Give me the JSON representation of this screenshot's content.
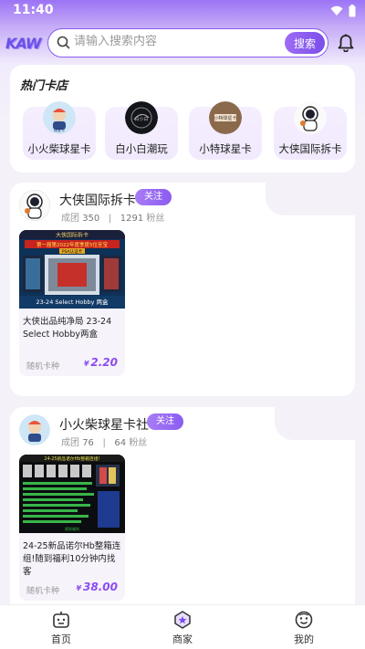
{
  "status": {
    "time": "11:40",
    "wifi_icon": "wifi-icon",
    "battery_icon": "battery-icon"
  },
  "header": {
    "logo": "KAW",
    "search_placeholder": "请输入搜索内容",
    "search_button": "搜索",
    "bell_icon": "bell-icon"
  },
  "hot_shops": {
    "title": "热门卡店",
    "items": [
      {
        "name": "小火柴球星卡"
      },
      {
        "name": "白小白潮玩"
      },
      {
        "name": "小特球星卡"
      },
      {
        "name": "大侠国际拆卡"
      }
    ]
  },
  "stores": [
    {
      "name": "大侠国际拆卡",
      "follow": "关注",
      "stats_label1": "成团",
      "stats_val1": "350",
      "stats_sep": "|",
      "stats_val2": "1291",
      "stats_label2": "粉丝",
      "product": {
        "img_line1": "大侠国际拆卡",
        "img_line2": "第一届第2022年度季度5位至宝",
        "img_badge": "PSA认证卡",
        "img_caption": "23-24 Select Hobby 两盒",
        "title": "大侠出品纯净局 23-24 Select Hobby两盒",
        "type": "随机卡种",
        "currency": "¥",
        "price": "2.20"
      }
    },
    {
      "name": "小火柴球星卡社",
      "follow": "关注",
      "stats_label1": "成团",
      "stats_val1": "76",
      "stats_sep": "|",
      "stats_val2": "64",
      "stats_label2": "粉丝",
      "product": {
        "img_line1": "24-25新品诺尔Hb整箱连组!",
        "img_line2": "随到福利",
        "title": "24-25新品诺尔Hb整箱连组!随到福利10分钟内找客",
        "type": "随机卡种",
        "currency": "¥",
        "price": "38.00"
      }
    }
  ],
  "bottom_nav": [
    {
      "label": "首页",
      "icon": "home-icon"
    },
    {
      "label": "商家",
      "icon": "store-icon"
    },
    {
      "label": "我的",
      "icon": "profile-icon"
    }
  ],
  "colors": {
    "accent": "#8b5cf0",
    "price": "#8b4cf0"
  }
}
